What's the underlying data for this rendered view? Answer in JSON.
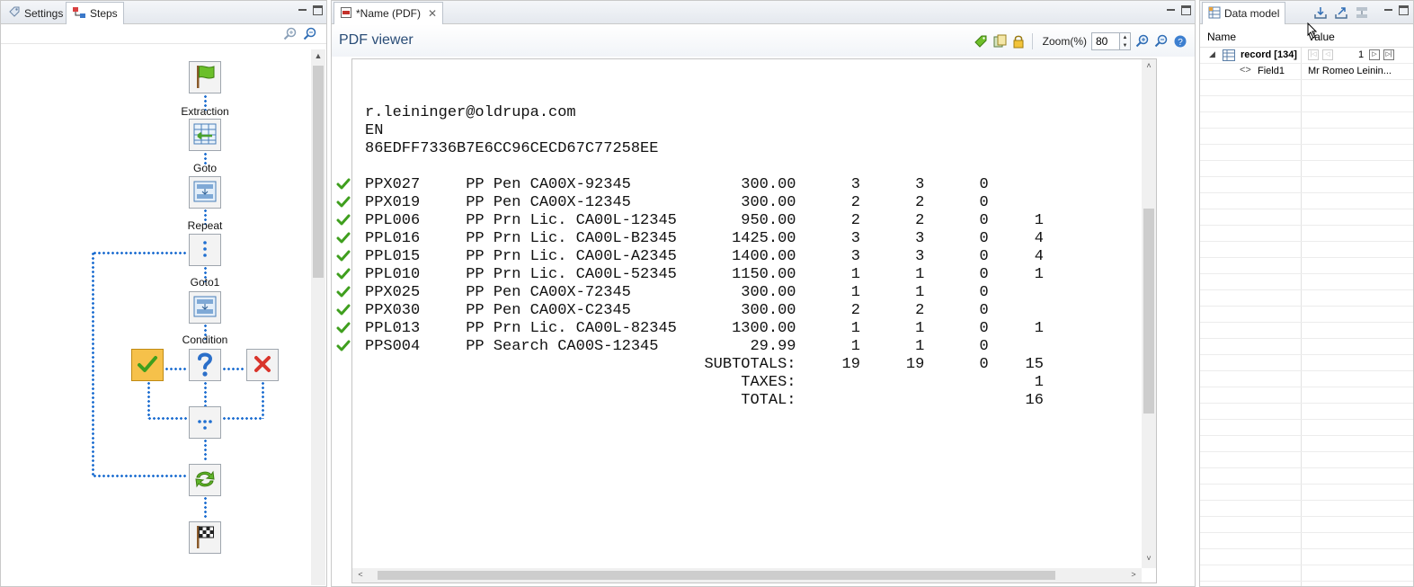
{
  "left_panel": {
    "tabs": [
      {
        "label": "Settings",
        "icon": "settings-icon",
        "active": false
      },
      {
        "label": "Steps",
        "icon": "steps-icon",
        "active": true
      }
    ],
    "flow": {
      "nodes": [
        {
          "name": "start",
          "label": "",
          "icon": "green-flag-icon"
        },
        {
          "name": "extraction",
          "label": "Extraction",
          "icon": "table-extract-icon"
        },
        {
          "name": "goto",
          "label": "Goto",
          "icon": "goto-icon"
        },
        {
          "name": "repeat",
          "label": "Repeat",
          "icon": "repeat-icon"
        },
        {
          "name": "goto1",
          "label": "Goto1",
          "icon": "goto-icon"
        },
        {
          "name": "condition",
          "label": "Condition",
          "icon": "question-icon"
        },
        {
          "name": "true-branch",
          "label": "",
          "icon": "check-icon"
        },
        {
          "name": "false-branch",
          "label": "",
          "icon": "x-icon"
        },
        {
          "name": "merge",
          "label": "",
          "icon": "merge-icon"
        },
        {
          "name": "loop",
          "label": "",
          "icon": "loop-icon"
        },
        {
          "name": "end",
          "label": "",
          "icon": "checkered-flag-icon"
        }
      ]
    }
  },
  "editor": {
    "tab_label": "*Name (PDF)",
    "title": "PDF viewer",
    "zoom_label": "Zoom(%)",
    "zoom_value": "80",
    "document_lines": [
      "r.leininger@oldrupa.com",
      "EN",
      "86EDFF7336B7E6CC96CECD67C77258EE",
      "",
      "PPX027     PP Pen CA00X-92345            300.00      3      3      0",
      "PPX019     PP Pen CA00X-12345            300.00      2      2      0",
      "PPL006     PP Prn Lic. CA00L-12345       950.00      2      2      0     1",
      "PPL016     PP Prn Lic. CA00L-B2345      1425.00      3      3      0     4",
      "PPL015     PP Prn Lic. CA00L-A2345      1400.00      3      3      0     4",
      "PPL010     PP Prn Lic. CA00L-52345      1150.00      1      1      0     1",
      "PPX025     PP Pen CA00X-72345            300.00      1      1      0",
      "PPX030     PP Pen CA00X-C2345            300.00      2      2      0",
      "PPL013     PP Prn Lic. CA00L-82345      1300.00      1      1      0     1",
      "PPS004     PP Search CA00S-12345          29.99      1      1      0",
      "                                     SUBTOTALS:     19     19      0    15",
      "                                         TAXES:                          1",
      "                                         TOTAL:                         16"
    ],
    "checked_rows": [
      5,
      6,
      7,
      8,
      9,
      10,
      11,
      12,
      13,
      14
    ]
  },
  "data_model": {
    "tab_label": "Data model",
    "columns": [
      "Name",
      "Value"
    ],
    "record_label": "record [134]",
    "record_index": "1",
    "field_name": "Field1",
    "field_value": "Mr Romeo Leinin..."
  }
}
